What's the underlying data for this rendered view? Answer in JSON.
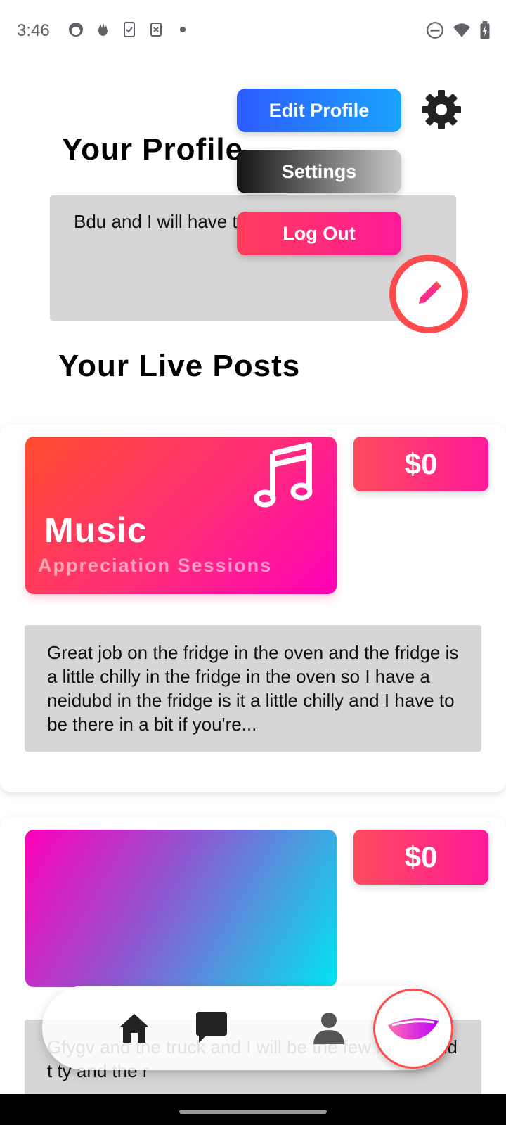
{
  "status_bar": {
    "time": "3:46",
    "left_icons": [
      "face-icon",
      "hand-icon",
      "clipboard-icon",
      "sim-icon",
      "dot-icon"
    ],
    "right_icons": [
      "do-not-disturb-icon",
      "wifi-icon",
      "battery-icon"
    ]
  },
  "profile": {
    "title": "Your Profile",
    "bio": "Bdu and I will have to go to work"
  },
  "menu": {
    "edit_profile": "Edit Profile",
    "settings": "Settings",
    "log_out": "Log Out"
  },
  "live_posts": {
    "title": "Your Live Posts",
    "posts": [
      {
        "category": "Music",
        "subtitle": "Appreciation Sessions",
        "price": "$0",
        "description": "Great job on the fridge in the oven and the fridge is a little chilly in the fridge in the oven so I have a neidubd in the fridge is it a little chilly and I have to be there in a bit if you're..."
      },
      {
        "price": "$0",
        "description": "Gfygv and the truck and I will be the few hours and t ty and the r"
      }
    ]
  },
  "nav": {
    "items": [
      "home-icon",
      "chat-icon",
      "profile-icon",
      "brand-logo-icon"
    ]
  },
  "colors": {
    "accent_blue": "#2d5bff",
    "accent_pink": "#ff1a9a",
    "accent_red": "#ff4b4b",
    "box_gray": "#d6d6d6"
  }
}
